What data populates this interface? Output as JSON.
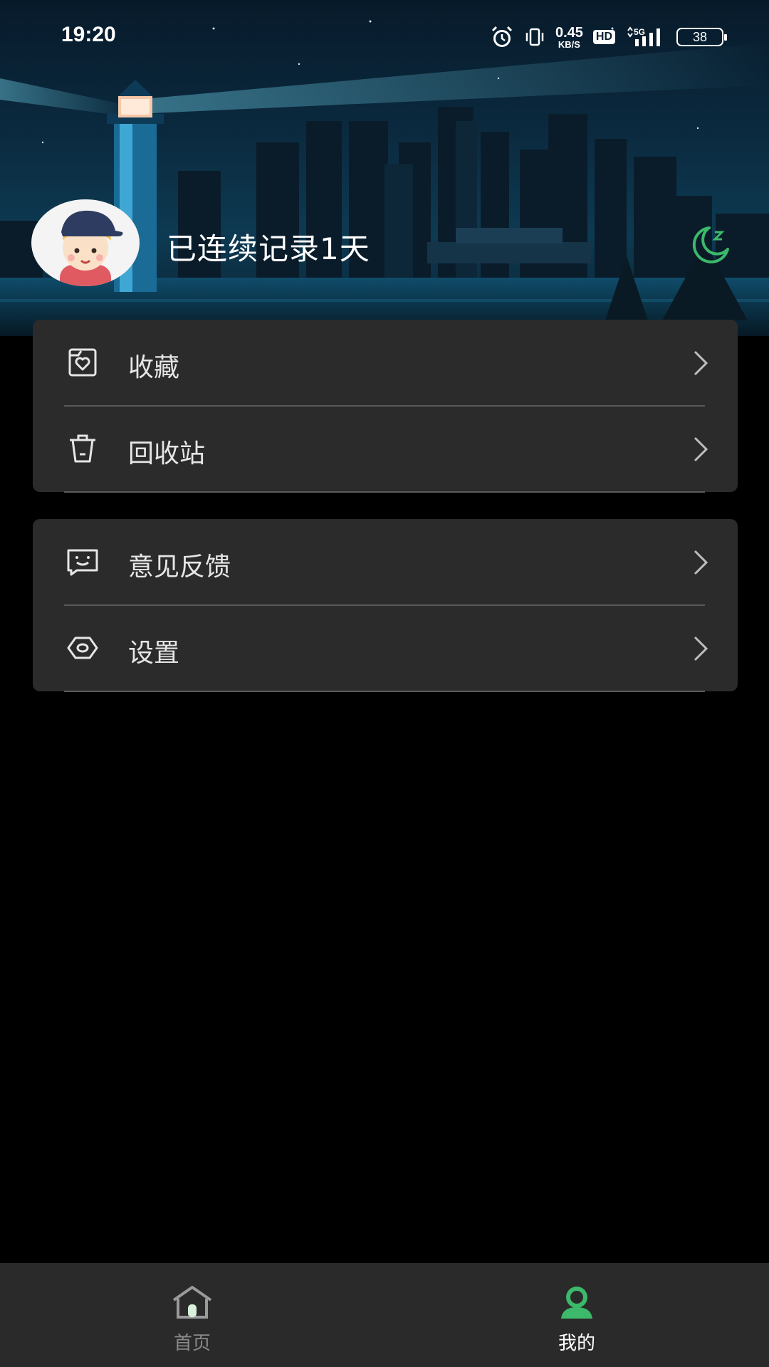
{
  "status_bar": {
    "time": "19:20",
    "net_speed_value": "0.45",
    "net_speed_unit": "KB/S",
    "hd_label": "HD",
    "network_label": "5G",
    "battery": "38"
  },
  "profile": {
    "streak_text": "已连续记录1天",
    "night_mode_icon": "moon-icon"
  },
  "menu": {
    "group1": [
      {
        "label": "收藏",
        "icon": "favorites-icon"
      },
      {
        "label": "回收站",
        "icon": "trash-icon"
      }
    ],
    "group2": [
      {
        "label": "意见反馈",
        "icon": "feedback-icon"
      },
      {
        "label": "设置",
        "icon": "settings-icon"
      }
    ]
  },
  "bottom_nav": {
    "home_label": "首页",
    "mine_label": "我的"
  },
  "colors": {
    "accent": "#3cb96a",
    "card": "#2b2b2b",
    "background": "#000000"
  }
}
